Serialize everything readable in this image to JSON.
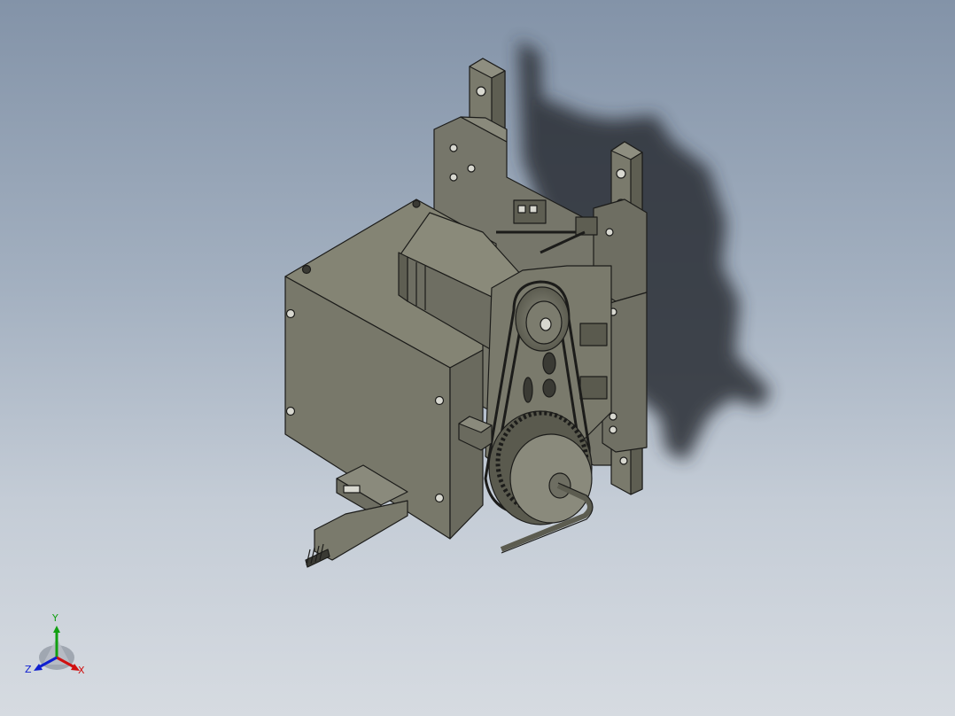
{
  "viewport": {
    "background_top": "#8393a8",
    "background_bottom": "#d6dbe1"
  },
  "model": {
    "part_color": "#787868",
    "edge_color": "#1c1c1a"
  },
  "triad": {
    "x_label": "X",
    "y_label": "Y",
    "z_label": "Z",
    "x_color": "#d01010",
    "y_color": "#11a011",
    "z_color": "#1020d0"
  }
}
